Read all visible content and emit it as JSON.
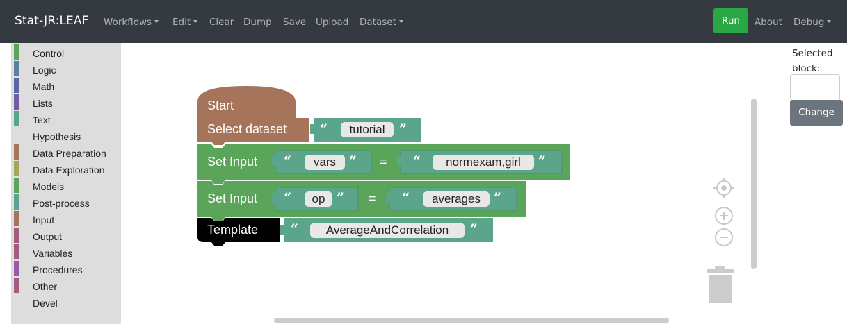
{
  "navbar": {
    "brand": "Stat-JR:LEAF",
    "items": [
      {
        "label": "Workflows",
        "dropdown": true
      },
      {
        "label": "Edit",
        "dropdown": true
      },
      {
        "label": "Clear",
        "dropdown": false
      },
      {
        "label": "Dump",
        "dropdown": false
      },
      {
        "label": "Save",
        "dropdown": false
      },
      {
        "label": "Upload",
        "dropdown": false
      },
      {
        "label": "Dataset",
        "dropdown": true
      }
    ],
    "run_label": "Run",
    "about_label": "About",
    "debug_label": "Debug"
  },
  "toolbox": {
    "categories": [
      {
        "label": "Control",
        "color": "#5ba55b"
      },
      {
        "label": "Logic",
        "color": "#5b80a5"
      },
      {
        "label": "Math",
        "color": "#5b67a5"
      },
      {
        "label": "Lists",
        "color": "#745ba5"
      },
      {
        "label": "Text",
        "color": "#5ba58c"
      },
      {
        "label": "Hypothesis",
        "color": ""
      },
      {
        "label": "Data Preparation",
        "color": "#a5745b"
      },
      {
        "label": "Data Exploration",
        "color": "#a5a55b"
      },
      {
        "label": "Models",
        "color": "#5ba55b"
      },
      {
        "label": "Post-process",
        "color": "#5ba58c"
      },
      {
        "label": "Input",
        "color": "#a5745b"
      },
      {
        "label": "Output",
        "color": "#a55b80"
      },
      {
        "label": "Variables",
        "color": "#a55b80"
      },
      {
        "label": "Procedures",
        "color": "#995ba5"
      },
      {
        "label": "Other",
        "color": "#a55b80"
      },
      {
        "label": "Devel",
        "color": ""
      }
    ]
  },
  "workspace": {
    "blocks": {
      "start_label": "Start",
      "select_dataset_label": "Select dataset",
      "dataset_value": "tutorial",
      "set_input_label": "Set Input",
      "set_input_1_key": "vars",
      "set_input_1_value": "normexam,girl",
      "set_input_2_key": "op",
      "set_input_2_value": "averages",
      "equals": "=",
      "template_label": "Template",
      "template_value": "AverageAndCorrelation",
      "open_quote": "“",
      "close_quote": "”"
    },
    "colors": {
      "start": "#a5745b",
      "set_input": "#5ba55b",
      "text": "#5ba58c",
      "template": "#000000"
    }
  },
  "side_panel": {
    "selected_block_label": "Selected block:",
    "selected_block_value": "",
    "change_label": "Change"
  },
  "colors": {
    "navbar_bg": "#343a40",
    "run_btn": "#28a745",
    "change_btn": "#6c757d",
    "toolbox_bg": "#dddddd"
  }
}
